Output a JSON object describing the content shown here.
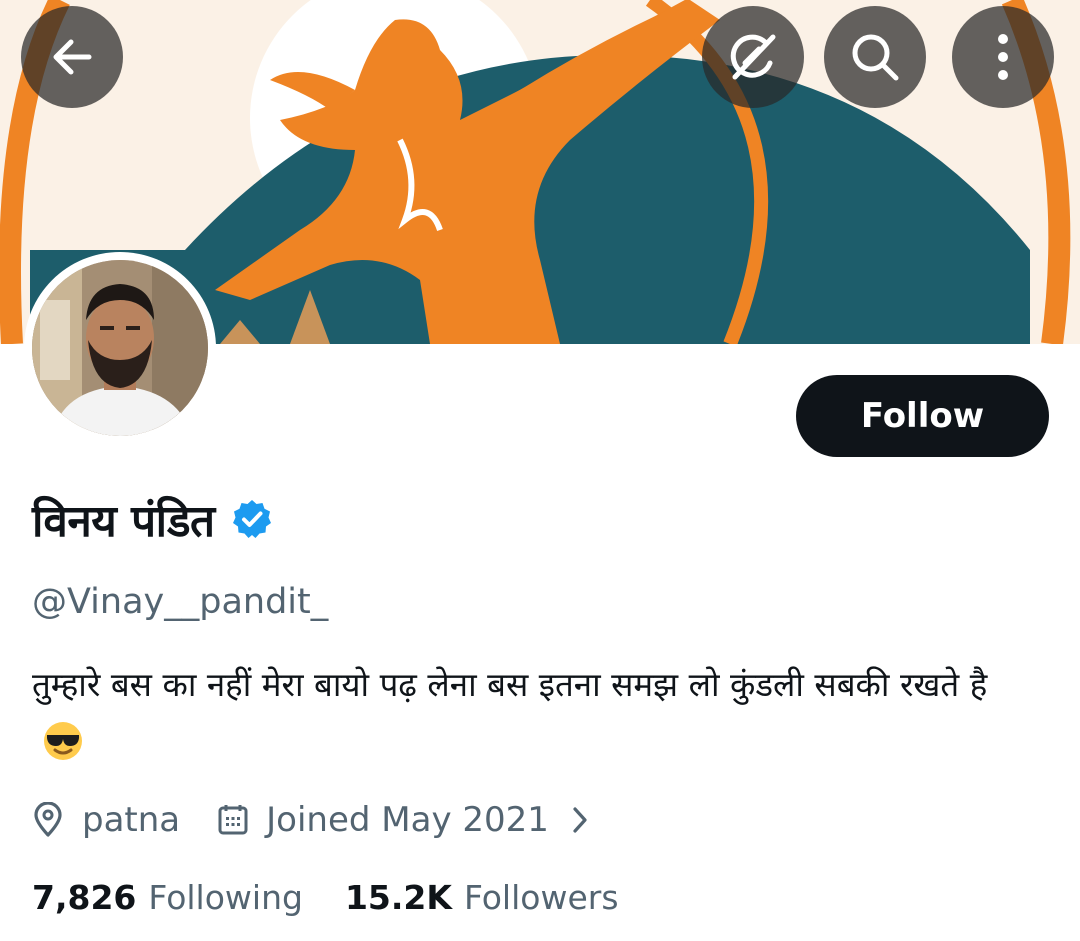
{
  "header": {
    "back_icon": "arrow-left-icon",
    "grok_icon": "grok-icon",
    "search_icon": "search-icon",
    "more_icon": "more-vertical-icon"
  },
  "profile": {
    "display_name": "विनय पंडित",
    "verified": true,
    "handle": "@Vinay__pandit_",
    "bio": "तुम्हारे बस का नहीं मेरा बायो पढ़ लेना  बस इतना समझ लो कुंडली सबकी रखते है",
    "bio_emoji": "smiling-face-with-sunglasses",
    "location": "patna",
    "joined": "Joined May 2021",
    "follow_label": "Follow"
  },
  "stats": {
    "following_count": "7,826",
    "following_label": "Following",
    "followers_count": "15.2K",
    "followers_label": "Followers"
  },
  "colors": {
    "accent_verified": "#1d9bf0",
    "primary_text": "#0f1419",
    "secondary_text": "#536471",
    "banner_orange": "#ef8424",
    "banner_teal": "#1d5d6b"
  }
}
